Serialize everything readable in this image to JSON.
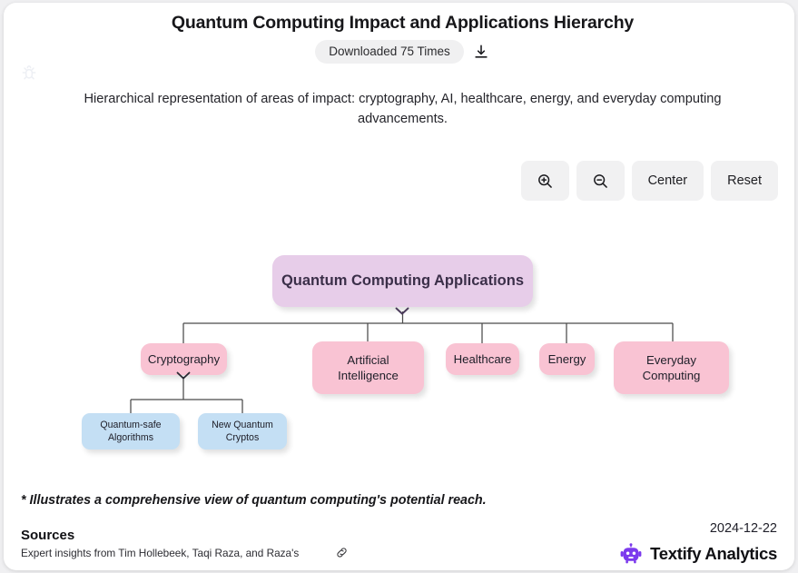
{
  "header": {
    "title": "Quantum Computing Impact and Applications Hierarchy",
    "download_badge": "Downloaded 75 Times",
    "download_icon": "download-icon",
    "bug_icon": "bug-icon",
    "subtitle": "Hierarchical representation of areas of impact: cryptography, AI, healthcare, energy, and everyday computing advancements."
  },
  "toolbar": {
    "zoom_in_icon": "zoom-in-icon",
    "zoom_out_icon": "zoom-out-icon",
    "center_label": "Center",
    "reset_label": "Reset"
  },
  "chart_data": {
    "type": "tree",
    "title": "Quantum Computing Impact and Applications Hierarchy",
    "root": {
      "id": "root",
      "label": "Quantum Computing Applications",
      "level": 0,
      "color": "#e7cde9",
      "expanded": true
    },
    "nodes": [
      {
        "id": "cryptography",
        "label": "Cryptography",
        "level": 1,
        "color": "#f9c3d3",
        "expanded": true,
        "parent": "root"
      },
      {
        "id": "artificial-intelligence",
        "label": "Artificial\nIntelligence",
        "line1": "Artificial",
        "line2": "Intelligence",
        "level": 1,
        "color": "#f9c3d3",
        "expanded": false,
        "parent": "root"
      },
      {
        "id": "healthcare",
        "label": "Healthcare",
        "level": 1,
        "color": "#f9c3d3",
        "expanded": false,
        "parent": "root"
      },
      {
        "id": "energy",
        "label": "Energy",
        "level": 1,
        "color": "#f9c3d3",
        "expanded": false,
        "parent": "root"
      },
      {
        "id": "everyday-computing",
        "label": "Everyday\nComputing",
        "line1": "Everyday",
        "line2": "Computing",
        "level": 1,
        "color": "#f9c3d3",
        "expanded": false,
        "parent": "root"
      },
      {
        "id": "quantum-safe-algorithms",
        "label": "Quantum-safe\nAlgorithms",
        "line1": "Quantum-safe",
        "line2": "Algorithms",
        "level": 2,
        "color": "#c4dff4",
        "expanded": false,
        "parent": "cryptography"
      },
      {
        "id": "new-quantum-cryptos",
        "label": "New Quantum\nCryptos",
        "line1": "New Quantum",
        "line2": "Cryptos",
        "level": 2,
        "color": "#c4dff4",
        "expanded": false,
        "parent": "cryptography"
      }
    ],
    "level_colors": {
      "0": "#e7cde9",
      "1": "#f9c3d3",
      "2": "#c4dff4"
    },
    "link_color": "#4a4a4a"
  },
  "footer": {
    "footnote": "* Illustrates a comprehensive view of quantum computing's potential reach.",
    "sources_heading": "Sources",
    "sources_text": "Expert insights from Tim Hollebeek, Taqi Raza, and Raza's",
    "link_icon": "link-icon",
    "date": "2024-12-22",
    "brand_name": "Textify Analytics",
    "brand_icon": "robot-icon",
    "brand_color": "#7c3aed"
  }
}
